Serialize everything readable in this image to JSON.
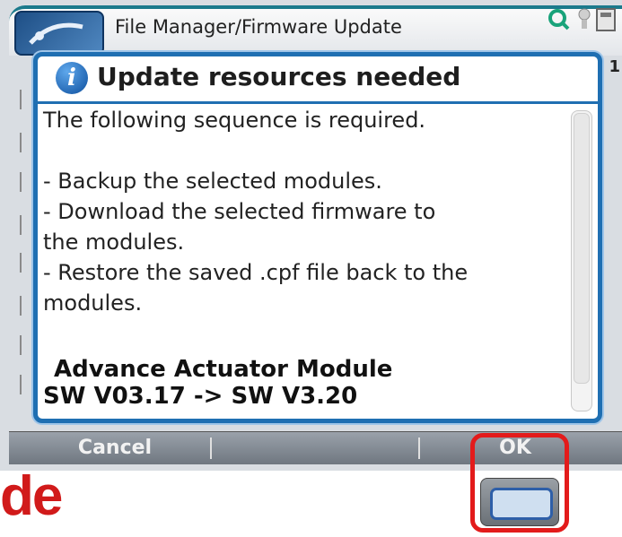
{
  "window": {
    "title": "File Manager/Firmware Update",
    "tray_right_digit": "1"
  },
  "dialog": {
    "title": "Update resources needed",
    "message": "The following sequence is required.\n\n- Backup the selected modules.\n- Download the selected firmware to\nthe modules.\n- Restore the saved .cpf file back to the\nmodules.",
    "module_name": "Advance Actuator Module",
    "module_version": "SW V03.17 -> SW V3.20"
  },
  "softkeys": {
    "cancel": "Cancel",
    "ok": "OK"
  },
  "device": {
    "brand_fragment": "de"
  },
  "colors": {
    "accent": "#1f6fb2",
    "highlight": "#e31b1b",
    "brand": "#d11a1a"
  }
}
